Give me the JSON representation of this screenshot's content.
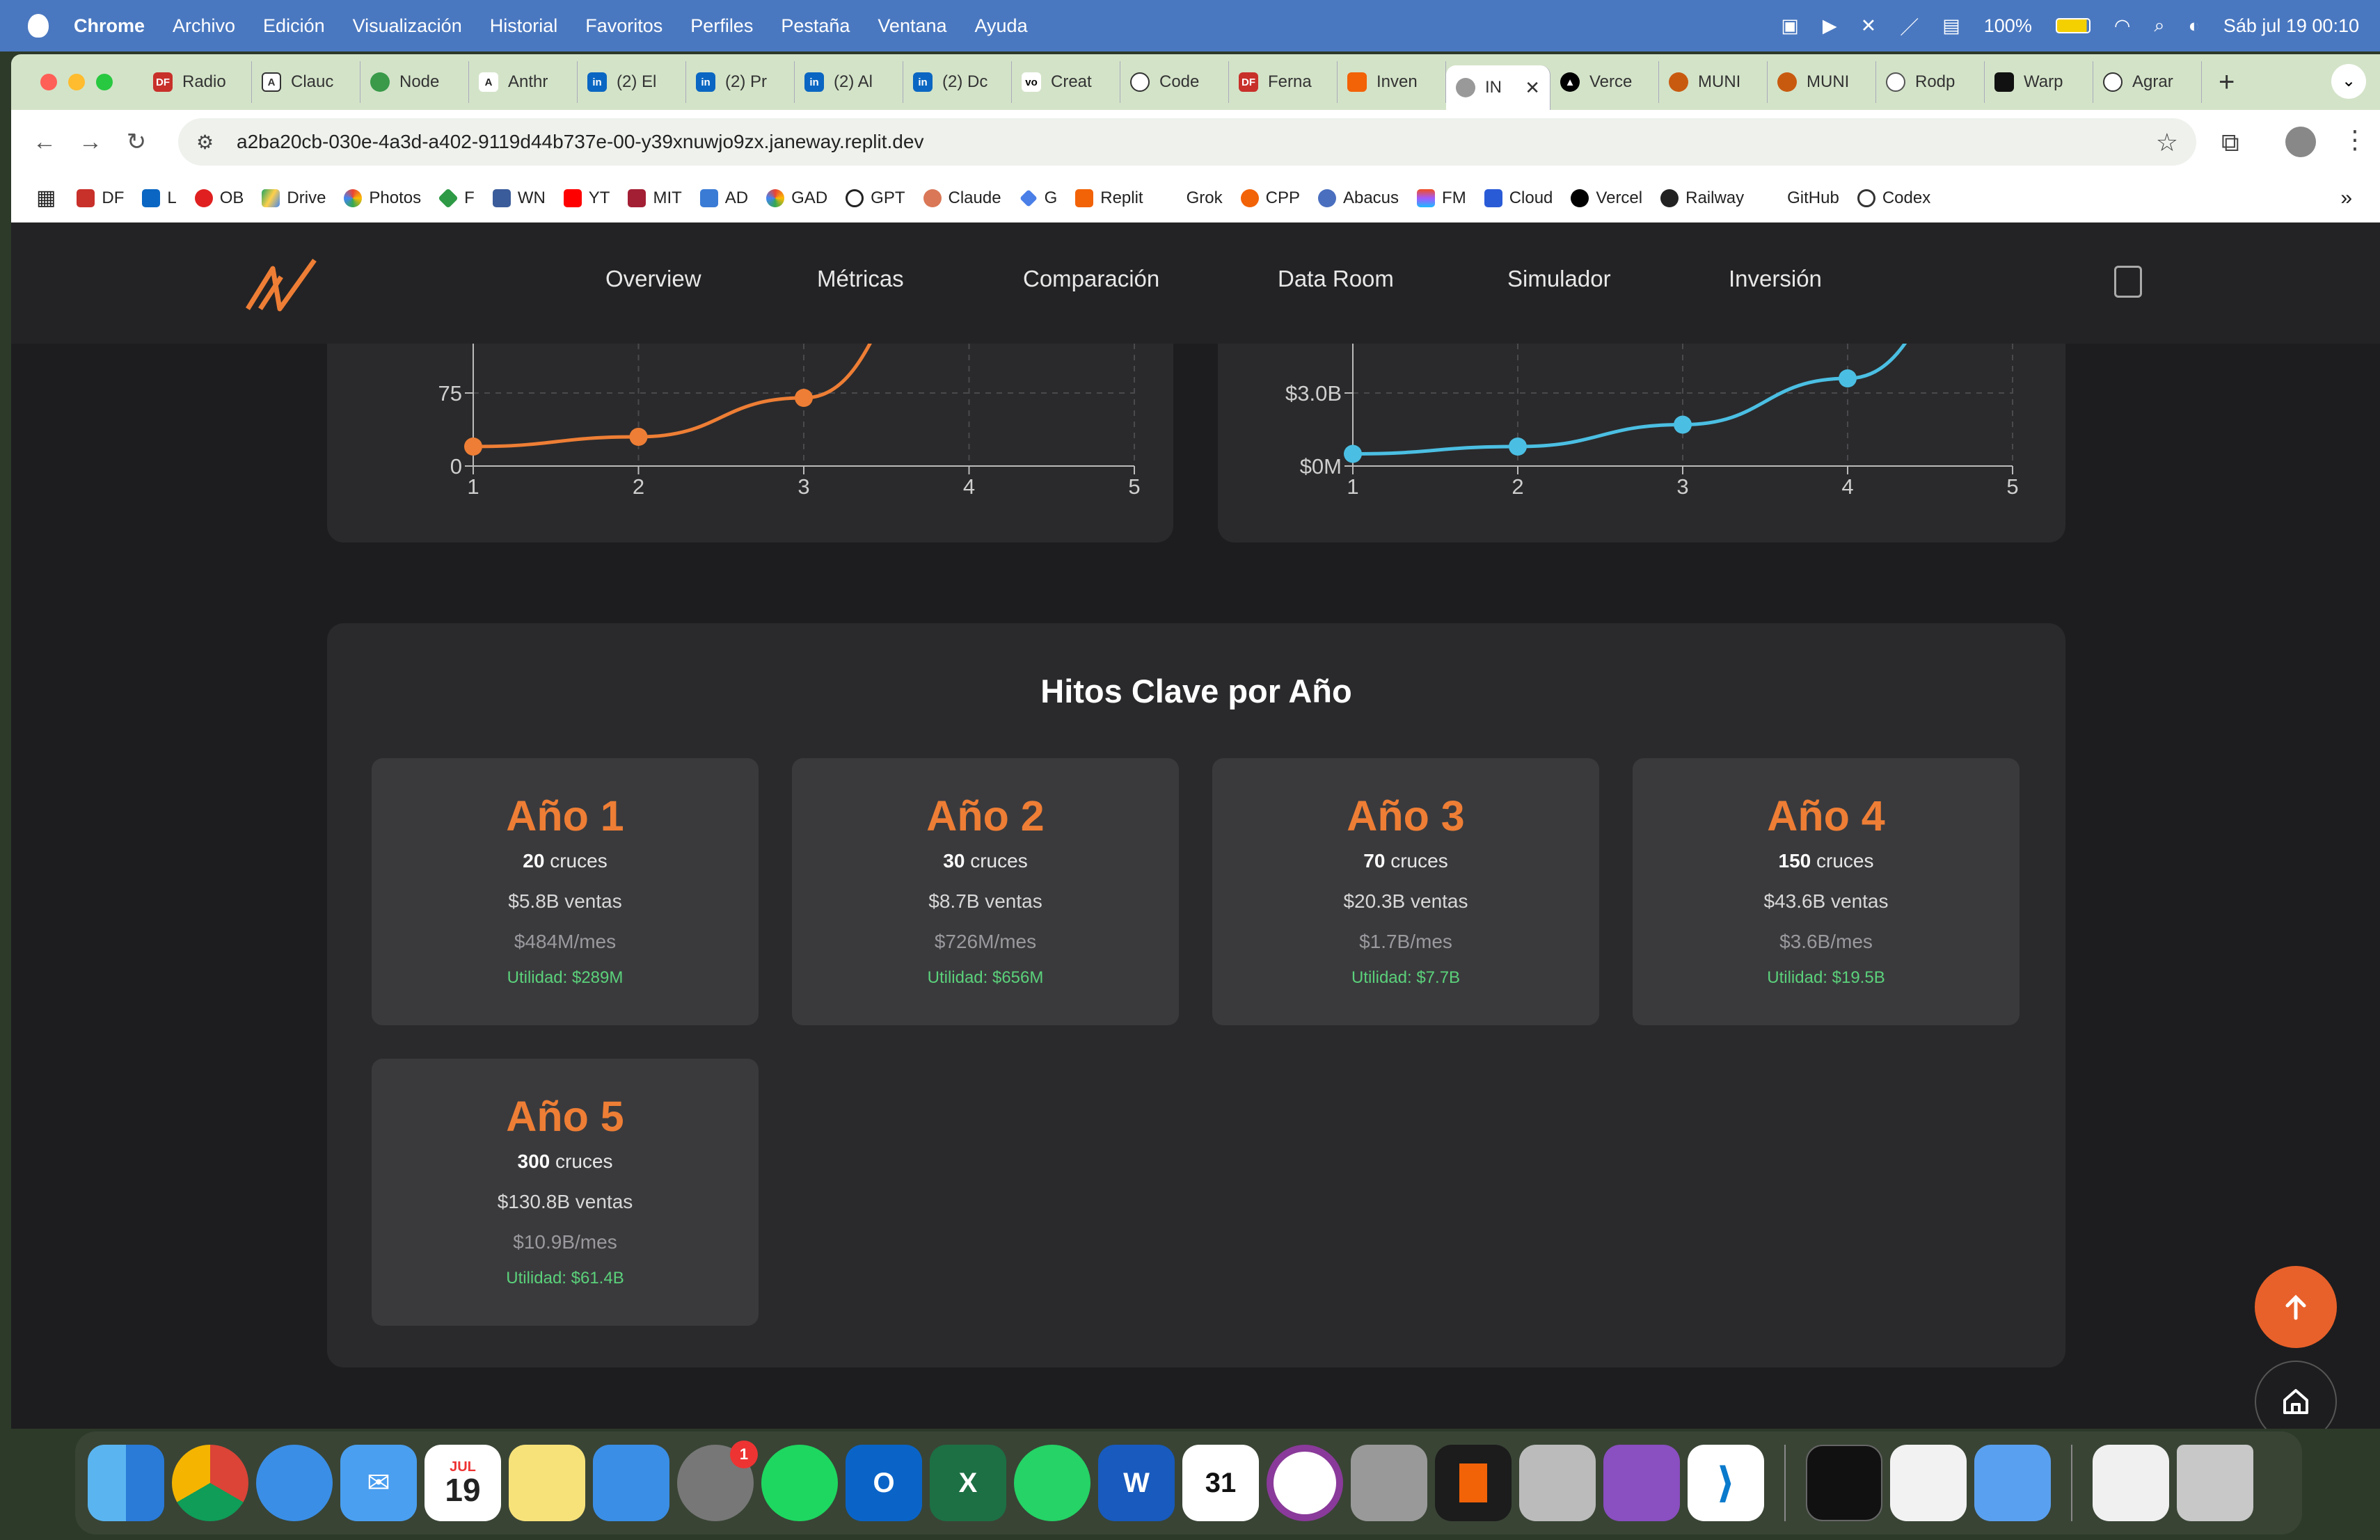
{
  "menubar": {
    "app": "Chrome",
    "items": [
      "Archivo",
      "Edición",
      "Visualización",
      "Historial",
      "Favoritos",
      "Perfiles",
      "Pestaña",
      "Ventana",
      "Ayuda"
    ],
    "battery": "100%",
    "clock": "Sáb jul 19  00:10"
  },
  "tabs": [
    "Radio",
    "Clauc",
    "Node",
    "Anthr",
    "(2) El",
    "(2) Pr",
    "(2) Al",
    "(2) Dc",
    "Creat",
    "Code",
    "Ferna",
    "Inven",
    "IN",
    "Verce",
    "MUNI",
    "MUNI",
    "Rodp",
    "Warp",
    "Agrar"
  ],
  "address": {
    "url": "a2ba20cb-030e-4a3d-a402-9119d44b737e-00-y39xnuwjo9zx.janeway.replit.dev"
  },
  "bookmarks": [
    "DF",
    "L",
    "OB",
    "Drive",
    "Photos",
    "F",
    "WN",
    "YT",
    "MIT",
    "AD",
    "GAD",
    "GPT",
    "Claude",
    "G",
    "Replit",
    "Grok",
    "CPP",
    "Abacus",
    "FM",
    "Cloud",
    "Vercel",
    "Railway",
    "GitHub",
    "Codex"
  ],
  "sitenav": {
    "links": [
      "Overview",
      "Métricas",
      "Comparación",
      "Data Room",
      "Simulador",
      "Inversión"
    ]
  },
  "colors": {
    "accent": "#ee7e35",
    "cyan": "#4bbfe3",
    "profit": "#5bd17a"
  },
  "chart_data": [
    {
      "type": "line",
      "x": [
        1,
        2,
        3
      ],
      "y": [
        20,
        30,
        70
      ],
      "ticks_y": [
        "75",
        "0"
      ],
      "ticks_x": [
        "1",
        "2",
        "3",
        "4",
        "5"
      ],
      "xlim": [
        1,
        5
      ]
    },
    {
      "type": "line",
      "x": [
        1,
        2,
        3,
        4
      ],
      "y": [
        0.5,
        0.8,
        1.7,
        3.6
      ],
      "ticks_y": [
        "$3.0B",
        "$0M"
      ],
      "ticks_x": [
        "1",
        "2",
        "3",
        "4",
        "5"
      ],
      "xlim": [
        1,
        5
      ]
    }
  ],
  "milestones": {
    "title": "Hitos Clave por Año",
    "years": [
      {
        "year": "Año 1",
        "crosses": "20",
        "crosses_label": "cruces",
        "sales": "$5.8B ventas",
        "monthly": "$484M/mes",
        "profit": "Utilidad: $289M"
      },
      {
        "year": "Año 2",
        "crosses": "30",
        "crosses_label": "cruces",
        "sales": "$8.7B ventas",
        "monthly": "$726M/mes",
        "profit": "Utilidad: $656M"
      },
      {
        "year": "Año 3",
        "crosses": "70",
        "crosses_label": "cruces",
        "sales": "$20.3B ventas",
        "monthly": "$1.7B/mes",
        "profit": "Utilidad: $7.7B"
      },
      {
        "year": "Año 4",
        "crosses": "150",
        "crosses_label": "cruces",
        "sales": "$43.6B ventas",
        "monthly": "$3.6B/mes",
        "profit": "Utilidad: $19.5B"
      },
      {
        "year": "Año 5",
        "crosses": "300",
        "crosses_label": "cruces",
        "sales": "$130.8B ventas",
        "monthly": "$10.9B/mes",
        "profit": "Utilidad: $61.4B"
      }
    ]
  },
  "dock": {
    "calendar_month": "JUL",
    "calendar_day": "19",
    "badge": "1"
  }
}
